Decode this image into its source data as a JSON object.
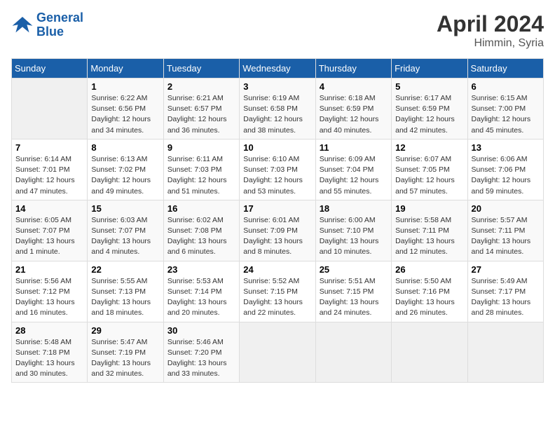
{
  "header": {
    "logo_line1": "General",
    "logo_line2": "Blue",
    "month": "April 2024",
    "location": "Himmin, Syria"
  },
  "weekdays": [
    "Sunday",
    "Monday",
    "Tuesday",
    "Wednesday",
    "Thursday",
    "Friday",
    "Saturday"
  ],
  "weeks": [
    [
      {
        "day": "",
        "content": ""
      },
      {
        "day": "1",
        "content": "Sunrise: 6:22 AM\nSunset: 6:56 PM\nDaylight: 12 hours\nand 34 minutes."
      },
      {
        "day": "2",
        "content": "Sunrise: 6:21 AM\nSunset: 6:57 PM\nDaylight: 12 hours\nand 36 minutes."
      },
      {
        "day": "3",
        "content": "Sunrise: 6:19 AM\nSunset: 6:58 PM\nDaylight: 12 hours\nand 38 minutes."
      },
      {
        "day": "4",
        "content": "Sunrise: 6:18 AM\nSunset: 6:59 PM\nDaylight: 12 hours\nand 40 minutes."
      },
      {
        "day": "5",
        "content": "Sunrise: 6:17 AM\nSunset: 6:59 PM\nDaylight: 12 hours\nand 42 minutes."
      },
      {
        "day": "6",
        "content": "Sunrise: 6:15 AM\nSunset: 7:00 PM\nDaylight: 12 hours\nand 45 minutes."
      }
    ],
    [
      {
        "day": "7",
        "content": "Sunrise: 6:14 AM\nSunset: 7:01 PM\nDaylight: 12 hours\nand 47 minutes."
      },
      {
        "day": "8",
        "content": "Sunrise: 6:13 AM\nSunset: 7:02 PM\nDaylight: 12 hours\nand 49 minutes."
      },
      {
        "day": "9",
        "content": "Sunrise: 6:11 AM\nSunset: 7:03 PM\nDaylight: 12 hours\nand 51 minutes."
      },
      {
        "day": "10",
        "content": "Sunrise: 6:10 AM\nSunset: 7:03 PM\nDaylight: 12 hours\nand 53 minutes."
      },
      {
        "day": "11",
        "content": "Sunrise: 6:09 AM\nSunset: 7:04 PM\nDaylight: 12 hours\nand 55 minutes."
      },
      {
        "day": "12",
        "content": "Sunrise: 6:07 AM\nSunset: 7:05 PM\nDaylight: 12 hours\nand 57 minutes."
      },
      {
        "day": "13",
        "content": "Sunrise: 6:06 AM\nSunset: 7:06 PM\nDaylight: 12 hours\nand 59 minutes."
      }
    ],
    [
      {
        "day": "14",
        "content": "Sunrise: 6:05 AM\nSunset: 7:07 PM\nDaylight: 13 hours\nand 1 minute."
      },
      {
        "day": "15",
        "content": "Sunrise: 6:03 AM\nSunset: 7:07 PM\nDaylight: 13 hours\nand 4 minutes."
      },
      {
        "day": "16",
        "content": "Sunrise: 6:02 AM\nSunset: 7:08 PM\nDaylight: 13 hours\nand 6 minutes."
      },
      {
        "day": "17",
        "content": "Sunrise: 6:01 AM\nSunset: 7:09 PM\nDaylight: 13 hours\nand 8 minutes."
      },
      {
        "day": "18",
        "content": "Sunrise: 6:00 AM\nSunset: 7:10 PM\nDaylight: 13 hours\nand 10 minutes."
      },
      {
        "day": "19",
        "content": "Sunrise: 5:58 AM\nSunset: 7:11 PM\nDaylight: 13 hours\nand 12 minutes."
      },
      {
        "day": "20",
        "content": "Sunrise: 5:57 AM\nSunset: 7:11 PM\nDaylight: 13 hours\nand 14 minutes."
      }
    ],
    [
      {
        "day": "21",
        "content": "Sunrise: 5:56 AM\nSunset: 7:12 PM\nDaylight: 13 hours\nand 16 minutes."
      },
      {
        "day": "22",
        "content": "Sunrise: 5:55 AM\nSunset: 7:13 PM\nDaylight: 13 hours\nand 18 minutes."
      },
      {
        "day": "23",
        "content": "Sunrise: 5:53 AM\nSunset: 7:14 PM\nDaylight: 13 hours\nand 20 minutes."
      },
      {
        "day": "24",
        "content": "Sunrise: 5:52 AM\nSunset: 7:15 PM\nDaylight: 13 hours\nand 22 minutes."
      },
      {
        "day": "25",
        "content": "Sunrise: 5:51 AM\nSunset: 7:15 PM\nDaylight: 13 hours\nand 24 minutes."
      },
      {
        "day": "26",
        "content": "Sunrise: 5:50 AM\nSunset: 7:16 PM\nDaylight: 13 hours\nand 26 minutes."
      },
      {
        "day": "27",
        "content": "Sunrise: 5:49 AM\nSunset: 7:17 PM\nDaylight: 13 hours\nand 28 minutes."
      }
    ],
    [
      {
        "day": "28",
        "content": "Sunrise: 5:48 AM\nSunset: 7:18 PM\nDaylight: 13 hours\nand 30 minutes."
      },
      {
        "day": "29",
        "content": "Sunrise: 5:47 AM\nSunset: 7:19 PM\nDaylight: 13 hours\nand 32 minutes."
      },
      {
        "day": "30",
        "content": "Sunrise: 5:46 AM\nSunset: 7:20 PM\nDaylight: 13 hours\nand 33 minutes."
      },
      {
        "day": "",
        "content": ""
      },
      {
        "day": "",
        "content": ""
      },
      {
        "day": "",
        "content": ""
      },
      {
        "day": "",
        "content": ""
      }
    ]
  ]
}
